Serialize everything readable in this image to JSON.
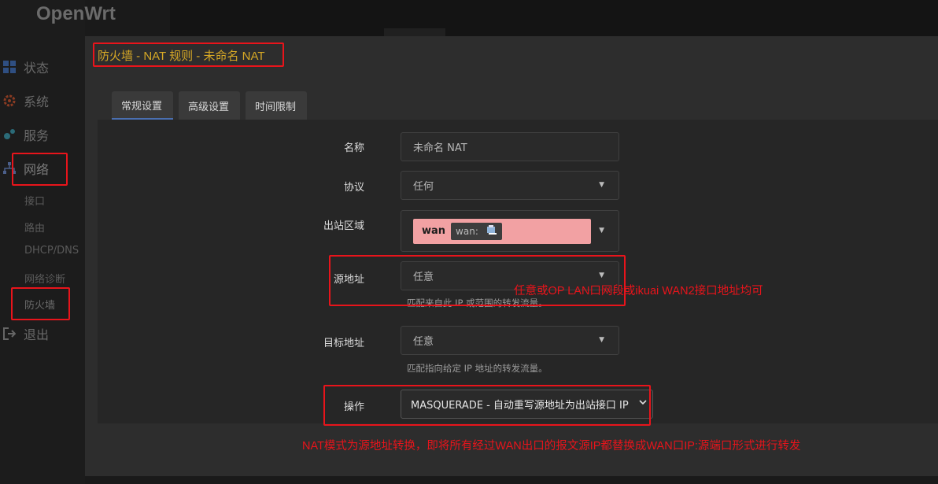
{
  "logo": "OpenWrt",
  "sidebar": {
    "items": [
      {
        "label": "状态",
        "icon": "dashboard-icon"
      },
      {
        "label": "系统",
        "icon": "gear-icon"
      },
      {
        "label": "服务",
        "icon": "services-icon"
      },
      {
        "label": "网络",
        "icon": "network-icon"
      },
      {
        "label": "退出",
        "icon": "logout-icon"
      }
    ],
    "sub_items": [
      "接口",
      "路由",
      "DHCP/DNS",
      "网络诊断",
      "防火墙"
    ]
  },
  "modal": {
    "title": "防火墙 - NAT 规则 - 未命名 NAT",
    "tabs": [
      "常规设置",
      "高级设置",
      "时间限制"
    ]
  },
  "form": {
    "name_label": "名称",
    "name_value": "未命名 NAT",
    "protocol_label": "协议",
    "protocol_value": "任何",
    "outbound_zone_label": "出站区域",
    "zone_tag": "wan",
    "zone_iface": "wan:",
    "src_label": "源地址",
    "src_value": "任意",
    "src_hint": "匹配来自此 IP 或范围的转发流量。",
    "dst_label": "目标地址",
    "dst_value": "任意",
    "dst_hint": "匹配指向给定 IP 地址的转发流量。",
    "action_label": "操作",
    "action_value": "MASQUERADE - 自动重写源地址为出站接口 IP"
  },
  "annotations": {
    "src_note": "任意或OP LAN口网段或ikuai WAN2接口地址均可",
    "nat_note": "NAT模式为源地址转换，即将所有经过WAN出口的报文源IP都替换成WAN口IP:源端口形式进行转发"
  },
  "colors": {
    "title": "#d6a826",
    "annotation": "#e8141b",
    "zone_tag_bg": "#f2a1a3",
    "tab_active_underline": "#4a6fb0"
  }
}
